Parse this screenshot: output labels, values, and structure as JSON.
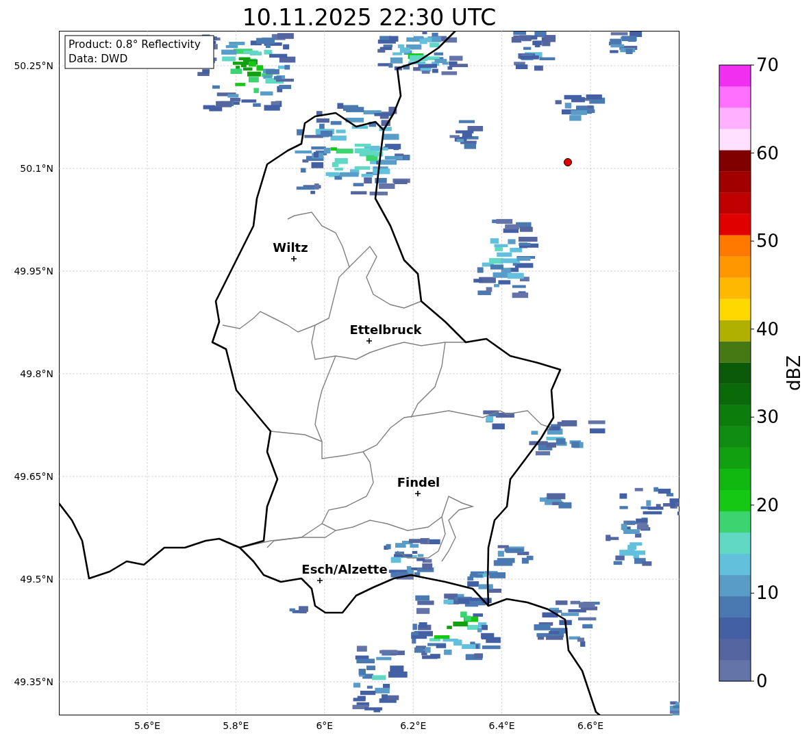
{
  "title": "10.11.2025 22:30 UTC",
  "map": {
    "info_box": [
      "Product: 0.8° Reflectivity",
      "Data: DWD"
    ],
    "lat_ticks": [
      "50.25°N",
      "50.1°N",
      "49.95°N",
      "49.8°N",
      "49.65°N",
      "49.5°N",
      "49.35°N"
    ],
    "lon_ticks": [
      "5.6°E",
      "5.8°E",
      "6°E",
      "6.2°E",
      "6.4°E",
      "6.6°E"
    ],
    "cities": [
      {
        "name": "Wiltz"
      },
      {
        "name": "Ettelbruck"
      },
      {
        "name": "Findel"
      },
      {
        "name": "Esch/Alzette"
      }
    ]
  },
  "colorbar": {
    "label": "dBZ",
    "ticks": [
      "70",
      "60",
      "50",
      "40",
      "30",
      "20",
      "10",
      "0"
    ],
    "segments": [
      {
        "color": "#6474a8"
      },
      {
        "color": "#5465a0"
      },
      {
        "color": "#4460a4"
      },
      {
        "color": "#4a78b0"
      },
      {
        "color": "#5a9cc8"
      },
      {
        "color": "#62c0dc"
      },
      {
        "color": "#60d8c4"
      },
      {
        "color": "#3cd470"
      },
      {
        "color": "#14c814"
      },
      {
        "color": "#10b810"
      },
      {
        "color": "#10a010"
      },
      {
        "color": "#108c10"
      },
      {
        "color": "#0c7c0c"
      },
      {
        "color": "#0a6a0a"
      },
      {
        "color": "#0a5a0a"
      },
      {
        "color": "#467814"
      },
      {
        "color": "#b0b000"
      },
      {
        "color": "#ffd800"
      },
      {
        "color": "#ffb800"
      },
      {
        "color": "#ff9800"
      },
      {
        "color": "#ff7800"
      },
      {
        "color": "#e00000"
      },
      {
        "color": "#c00000"
      },
      {
        "color": "#a00000"
      },
      {
        "color": "#800000"
      },
      {
        "color": "#ffe0ff"
      },
      {
        "color": "#ffb0ff"
      },
      {
        "color": "#ff70ff"
      },
      {
        "color": "#f030f0"
      }
    ]
  }
}
